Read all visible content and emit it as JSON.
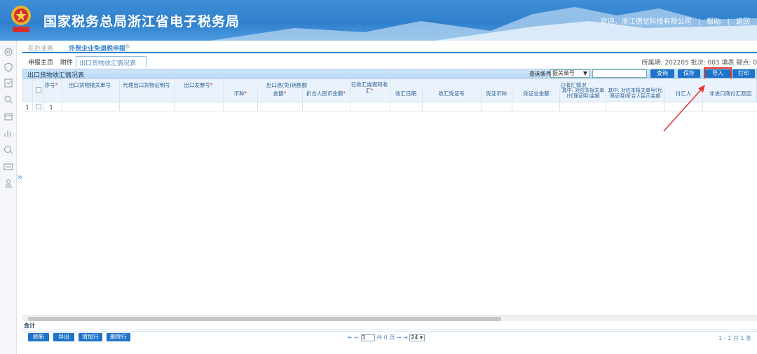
{
  "header": {
    "site_title": "国家税务总局浙江省电子税务局",
    "welcome": "欢迎，浙江德觉科技有限公司",
    "help": "帮助",
    "back": "返回"
  },
  "tabs1": {
    "pending": "在办业务",
    "current": "外贸企业免退税申报"
  },
  "tabs2": {
    "home": "申报主页",
    "attachment": "附件",
    "active": "出口货物收汇情况表"
  },
  "period": "所属期: 202205 批次: 003 填表 疑点: 0",
  "toolbar": {
    "title": "出口货物收汇情况表",
    "query_label": "查询条件",
    "query_option": "报关单号",
    "query_btn": "查询",
    "save_btn": "保存",
    "import_btn": "导入Excel",
    "print_btn": "打印"
  },
  "table": {
    "headers": {
      "seq": "序号",
      "declaration_no": "出口货物报关单号",
      "agent_cert": "代理出口货物证明号",
      "invoice_no": "出口发票号",
      "export_amount_group": "出口退(免)销售额",
      "currency": "币种",
      "amount": "金额",
      "rmb_amount": "折合人民币金额",
      "collected_flag": "已收汇或视同收汇",
      "collected_group": "已收汇情况",
      "collect_date": "收汇日期",
      "voucher_no": "收汇凭证号",
      "voucher_currency": "凭证币种",
      "voucher_total": "凭证总金额",
      "matched_amount": "其中: 对应本报关单(代理证明)金额",
      "matched_rmb": "其中: 对应本报关单号(代理证明)折合人民币金额",
      "payer": "付汇人",
      "non_payer": "非进口商付汇原因"
    },
    "row": {
      "index": "1",
      "seq": "1"
    },
    "total_label": "合计"
  },
  "footer": {
    "refresh": "刷新",
    "export": "导出",
    "add_row": "增加行",
    "delete_row": "删除行",
    "page_input": "1",
    "page_total": "共 0 页",
    "page_size": "24",
    "record_count": "1 - 1  共 1 条"
  },
  "colors": {
    "brand": "#2f7fcc",
    "button": "#1e73c8",
    "highlight": "#e53935"
  }
}
